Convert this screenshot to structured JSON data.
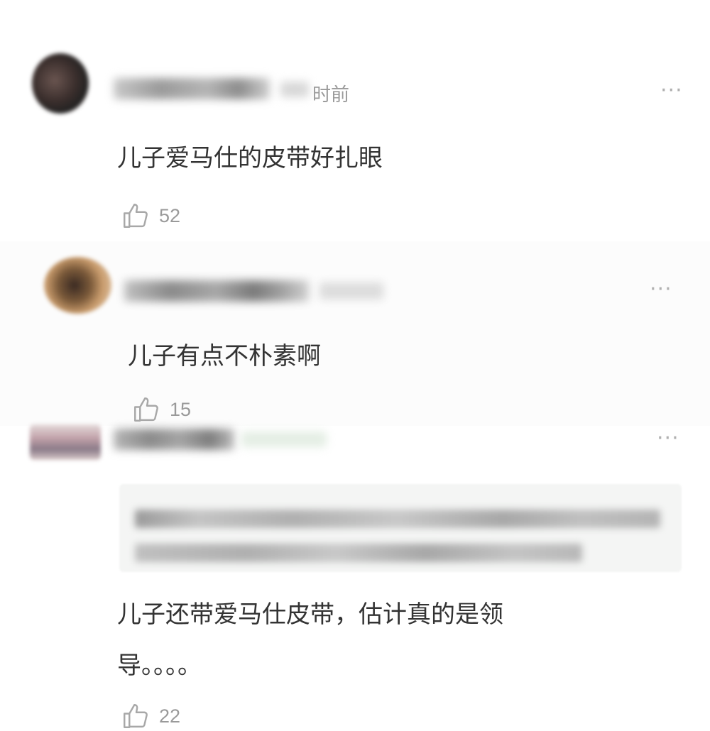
{
  "comments": [
    {
      "time_suffix": "时前",
      "more_label": "···",
      "text": "儿子爱马仕的皮带好扎眼",
      "likes": "52",
      "avatar_colors": [
        "#5a4a44",
        "#2b2b2b",
        "#e3a09a"
      ]
    },
    {
      "more_label": "···",
      "text": "儿子有点不朴素啊",
      "likes": "15",
      "avatar_colors": [
        "#c89b6c",
        "#3a2a22",
        "#7b5a3a"
      ]
    },
    {
      "more_label": "···",
      "text_line1": "儿子还带爱马仕皮带，估计真的是领",
      "text_line2": "导。。。。",
      "likes": "22",
      "avatar_colors": [
        "#d8c8c8",
        "#8a7a88",
        "#c0a0a8"
      ]
    }
  ],
  "icons": {
    "like": "thumbs-up-icon",
    "more": "more-dots-icon"
  }
}
